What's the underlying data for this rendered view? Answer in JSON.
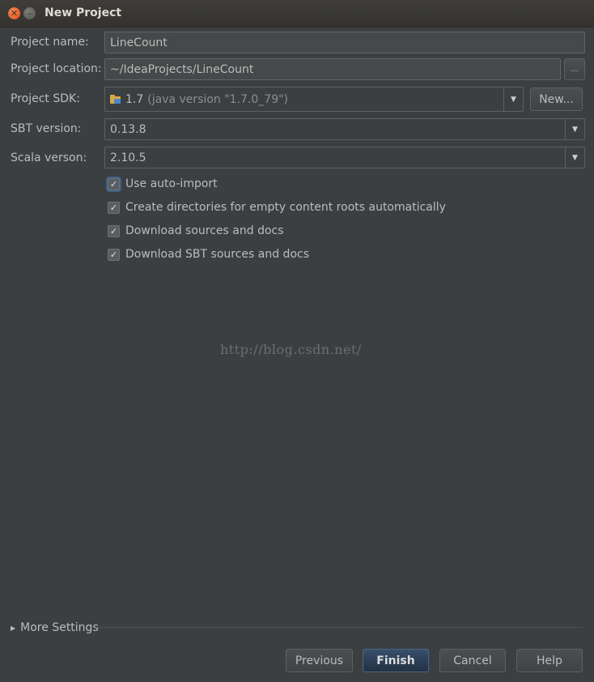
{
  "window": {
    "title": "New Project"
  },
  "form": {
    "project_name_label": "Project name:",
    "project_name_value": "LineCount",
    "project_location_label": "Project location:",
    "project_location_value": "~/IdeaProjects/LineCount",
    "browse_label": "...",
    "project_sdk_label": "Project SDK:",
    "sdk_version": "1.7",
    "sdk_detail": "(java version \"1.7.0_79\")",
    "new_button_label": "New...",
    "sbt_version_label": "SBT version:",
    "sbt_version_value": "0.13.8",
    "scala_version_label": "Scala verson:",
    "scala_version_value": "2.10.5"
  },
  "options": [
    {
      "label": "Use auto-import",
      "checked": true
    },
    {
      "label": "Create directories for empty content roots automatically",
      "checked": true
    },
    {
      "label": "Download sources and docs",
      "checked": true
    },
    {
      "label": "Download SBT sources and docs",
      "checked": true
    }
  ],
  "watermark": "http://blog.csdn.net/",
  "more_settings": "More Settings",
  "buttons": {
    "previous": "Previous",
    "finish": "Finish",
    "cancel": "Cancel",
    "help": "Help"
  },
  "icons": {
    "close": "close-icon",
    "minimize": "minimize-icon",
    "folder": "folder-icon",
    "dropdown": "chevron-down-icon",
    "expand": "triangle-right-icon",
    "check": "checkmark-icon"
  },
  "colors": {
    "background": "#3c3f41",
    "field": "#45494a",
    "default_button": "#2f4a68"
  }
}
